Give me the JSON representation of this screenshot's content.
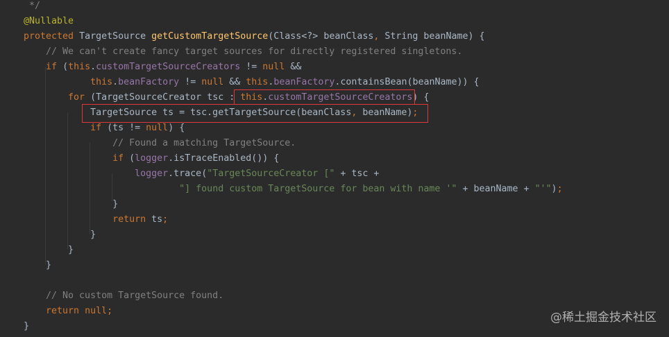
{
  "editor": {
    "theme_colors": {
      "background": "#2b2b2b",
      "text": "#a9b7c6",
      "keyword": "#cc7832",
      "field": "#9876aa",
      "method": "#ffc66d",
      "string": "#6a8759",
      "comment": "#808080",
      "annotation": "#bbb529",
      "highlight_box": "#e0373b"
    },
    "lines": [
      {
        "parts": [
          {
            "t": " */",
            "c": "cmt"
          }
        ]
      },
      {
        "parts": [
          {
            "t": "@Nullable",
            "c": "ann"
          }
        ]
      },
      {
        "parts": [
          {
            "t": "protected ",
            "c": "kw"
          },
          {
            "t": "TargetSource "
          },
          {
            "t": "getCustomTargetSource",
            "c": "fn"
          },
          {
            "t": "(Class<?> beanClass"
          },
          {
            "t": ", ",
            "c": "kw"
          },
          {
            "t": "String beanName) {"
          }
        ]
      },
      {
        "parts": [
          {
            "t": "    // We can't create fancy target sources for directly registered singletons.",
            "c": "cmt"
          }
        ]
      },
      {
        "parts": [
          {
            "t": "    "
          },
          {
            "t": "if ",
            "c": "kw"
          },
          {
            "t": "("
          },
          {
            "t": "this",
            "c": "kw"
          },
          {
            "t": "."
          },
          {
            "t": "customTargetSourceCreators",
            "c": "fld"
          },
          {
            "t": " != "
          },
          {
            "t": "null ",
            "c": "kw"
          },
          {
            "t": "&&"
          }
        ]
      },
      {
        "parts": [
          {
            "t": "            "
          },
          {
            "t": "this",
            "c": "kw"
          },
          {
            "t": "."
          },
          {
            "t": "beanFactory",
            "c": "fld"
          },
          {
            "t": " != "
          },
          {
            "t": "null ",
            "c": "kw"
          },
          {
            "t": "&& "
          },
          {
            "t": "this",
            "c": "kw"
          },
          {
            "t": "."
          },
          {
            "t": "beanFactory",
            "c": "fld"
          },
          {
            "t": ".containsBean(beanName)) {"
          }
        ]
      },
      {
        "parts": [
          {
            "t": "        "
          },
          {
            "t": "for ",
            "c": "kw"
          },
          {
            "t": "(TargetSourceCreator tsc : "
          },
          {
            "t": "this",
            "c": "kw"
          },
          {
            "t": "."
          },
          {
            "t": "customTargetSourceCreators",
            "c": "fld"
          },
          {
            "t": ") {"
          }
        ]
      },
      {
        "parts": [
          {
            "t": "            TargetSource ts = tsc.getTargetSource(beanClass"
          },
          {
            "t": ", ",
            "c": "kw"
          },
          {
            "t": "beanName)"
          },
          {
            "t": ";",
            "c": "kw"
          }
        ]
      },
      {
        "parts": [
          {
            "t": "            "
          },
          {
            "t": "if ",
            "c": "kw"
          },
          {
            "t": "(ts != "
          },
          {
            "t": "null",
            "c": "kw"
          },
          {
            "t": ") {"
          }
        ]
      },
      {
        "parts": [
          {
            "t": "                // Found a matching TargetSource.",
            "c": "cmt"
          }
        ]
      },
      {
        "parts": [
          {
            "t": "                "
          },
          {
            "t": "if ",
            "c": "kw"
          },
          {
            "t": "("
          },
          {
            "t": "logger",
            "c": "fld"
          },
          {
            "t": ".isTraceEnabled()) {"
          }
        ]
      },
      {
        "parts": [
          {
            "t": "                    "
          },
          {
            "t": "logger",
            "c": "fld"
          },
          {
            "t": ".trace("
          },
          {
            "t": "\"TargetSourceCreator [\"",
            "c": "str"
          },
          {
            "t": " + tsc +"
          }
        ]
      },
      {
        "parts": [
          {
            "t": "                            "
          },
          {
            "t": "\"] found custom TargetSource for bean with name '\"",
            "c": "str"
          },
          {
            "t": " + beanName + "
          },
          {
            "t": "\"'\"",
            "c": "str"
          },
          {
            "t": ")"
          },
          {
            "t": ";",
            "c": "kw"
          }
        ]
      },
      {
        "parts": [
          {
            "t": "                }"
          }
        ]
      },
      {
        "parts": [
          {
            "t": "                "
          },
          {
            "t": "return ",
            "c": "kw"
          },
          {
            "t": "ts"
          },
          {
            "t": ";",
            "c": "kw"
          }
        ]
      },
      {
        "parts": [
          {
            "t": "            }"
          }
        ]
      },
      {
        "parts": [
          {
            "t": "        }"
          }
        ]
      },
      {
        "parts": [
          {
            "t": "    }"
          }
        ]
      },
      {
        "parts": [
          {
            "t": ""
          }
        ]
      },
      {
        "parts": [
          {
            "t": "    // No custom TargetSource found.",
            "c": "cmt"
          }
        ]
      },
      {
        "parts": [
          {
            "t": "    "
          },
          {
            "t": "return null",
            "c": "kw"
          },
          {
            "t": ";",
            "c": "kw"
          }
        ]
      },
      {
        "parts": [
          {
            "t": "}"
          }
        ]
      }
    ]
  },
  "watermark": "@稀土掘金技术社区"
}
